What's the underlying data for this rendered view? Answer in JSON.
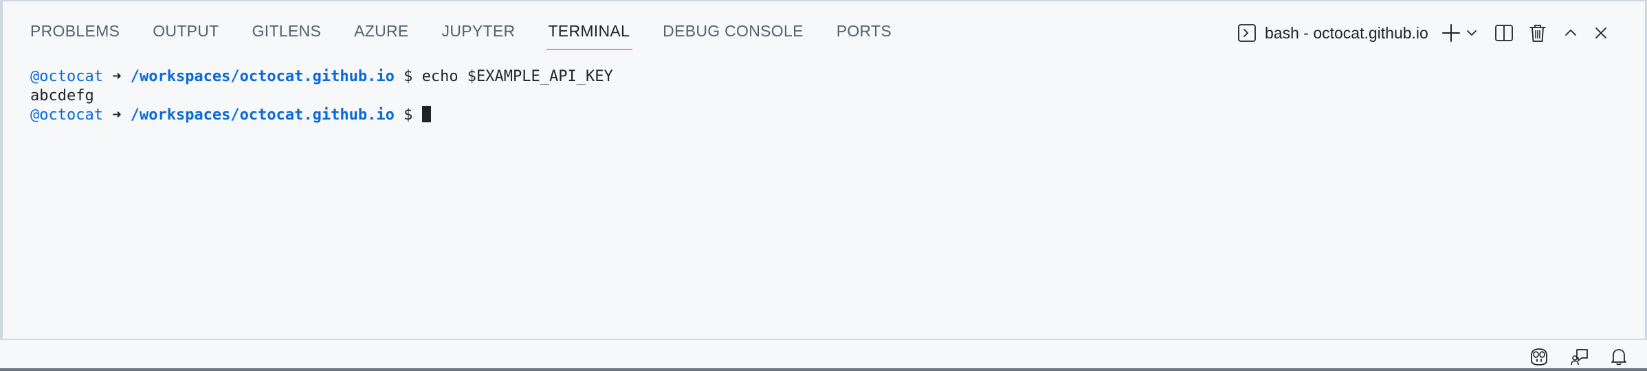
{
  "tabs": [
    {
      "label": "PROBLEMS",
      "active": false
    },
    {
      "label": "OUTPUT",
      "active": false
    },
    {
      "label": "GITLENS",
      "active": false
    },
    {
      "label": "AZURE",
      "active": false
    },
    {
      "label": "JUPYTER",
      "active": false
    },
    {
      "label": "TERMINAL",
      "active": true
    },
    {
      "label": "DEBUG CONSOLE",
      "active": false
    },
    {
      "label": "PORTS",
      "active": false
    }
  ],
  "terminal_selector": {
    "label": "bash - octocat.github.io",
    "icon": "terminal-icon"
  },
  "actions": {
    "new_terminal_icon": "plus-icon",
    "dropdown_icon": "chevron-down-icon",
    "split_icon": "split-icon",
    "kill_icon": "trash-icon",
    "maximize_icon": "chevron-up-icon",
    "close_icon": "close-icon"
  },
  "terminal": {
    "lines": [
      {
        "user": "@octocat",
        "arrow": "➜",
        "path": "/workspaces/octocat.github.io",
        "prompt": "$",
        "command": "echo $EXAMPLE_API_KEY"
      },
      {
        "output": "abcdefg"
      },
      {
        "user": "@octocat",
        "arrow": "➜",
        "path": "/workspaces/octocat.github.io",
        "prompt": "$",
        "command": ""
      }
    ]
  },
  "statusbar": {
    "icons": [
      "copilot-icon",
      "feedback-icon",
      "bell-icon"
    ]
  },
  "colors": {
    "accent_tab_underline": "#fd8c73",
    "prompt_blue": "#0969da",
    "background": "#f6f8fa"
  }
}
